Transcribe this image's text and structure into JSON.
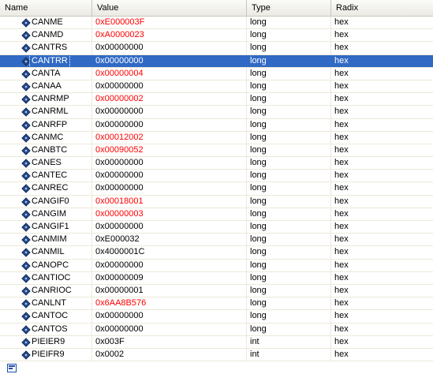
{
  "header": {
    "name": "Name",
    "value": "Value",
    "type": "Type",
    "radix": "Radix"
  },
  "colors": {
    "selection": "#316ac5",
    "changed_value": "#ff0000"
  },
  "rows": [
    {
      "name": "CANME",
      "value": "0xE000003F",
      "type": "long",
      "radix": "hex",
      "changed": true
    },
    {
      "name": "CANMD",
      "value": "0xA0000023",
      "type": "long",
      "radix": "hex",
      "changed": true
    },
    {
      "name": "CANTRS",
      "value": "0x00000000",
      "type": "long",
      "radix": "hex",
      "changed": false
    },
    {
      "name": "CANTRR",
      "value": "0x00000000",
      "type": "long",
      "radix": "hex",
      "changed": false,
      "selected": true
    },
    {
      "name": "CANTA",
      "value": "0x00000004",
      "type": "long",
      "radix": "hex",
      "changed": true
    },
    {
      "name": "CANAA",
      "value": "0x00000000",
      "type": "long",
      "radix": "hex",
      "changed": false
    },
    {
      "name": "CANRMP",
      "value": "0x00000002",
      "type": "long",
      "radix": "hex",
      "changed": true
    },
    {
      "name": "CANRML",
      "value": "0x00000000",
      "type": "long",
      "radix": "hex",
      "changed": false
    },
    {
      "name": "CANRFP",
      "value": "0x00000000",
      "type": "long",
      "radix": "hex",
      "changed": false
    },
    {
      "name": "CANMC",
      "value": "0x00012002",
      "type": "long",
      "radix": "hex",
      "changed": true
    },
    {
      "name": "CANBTC",
      "value": "0x00090052",
      "type": "long",
      "radix": "hex",
      "changed": true
    },
    {
      "name": "CANES",
      "value": "0x00000000",
      "type": "long",
      "radix": "hex",
      "changed": false
    },
    {
      "name": "CANTEC",
      "value": "0x00000000",
      "type": "long",
      "radix": "hex",
      "changed": false
    },
    {
      "name": "CANREC",
      "value": "0x00000000",
      "type": "long",
      "radix": "hex",
      "changed": false
    },
    {
      "name": "CANGIF0",
      "value": "0x00018001",
      "type": "long",
      "radix": "hex",
      "changed": true
    },
    {
      "name": "CANGIM",
      "value": "0x00000003",
      "type": "long",
      "radix": "hex",
      "changed": true
    },
    {
      "name": "CANGIF1",
      "value": "0x00000000",
      "type": "long",
      "radix": "hex",
      "changed": false
    },
    {
      "name": "CANMIM",
      "value": "0xE000032",
      "type": "long",
      "radix": "hex",
      "changed": false
    },
    {
      "name": "CANMIL",
      "value": "0x4000001C",
      "type": "long",
      "radix": "hex",
      "changed": false
    },
    {
      "name": "CANOPC",
      "value": "0x00000000",
      "type": "long",
      "radix": "hex",
      "changed": false
    },
    {
      "name": "CANTIOC",
      "value": "0x00000009",
      "type": "long",
      "radix": "hex",
      "changed": false
    },
    {
      "name": "CANRIOC",
      "value": "0x00000001",
      "type": "long",
      "radix": "hex",
      "changed": false
    },
    {
      "name": "CANLNT",
      "value": "0x6AA8B576",
      "type": "long",
      "radix": "hex",
      "changed": true
    },
    {
      "name": "CANTOC",
      "value": "0x00000000",
      "type": "long",
      "radix": "hex",
      "changed": false
    },
    {
      "name": "CANTOS",
      "value": "0x00000000",
      "type": "long",
      "radix": "hex",
      "changed": false
    },
    {
      "name": "PIEIER9",
      "value": "0x003F",
      "type": "int",
      "radix": "hex",
      "changed": false
    },
    {
      "name": "PIEIFR9",
      "value": "0x0002",
      "type": "int",
      "radix": "hex",
      "changed": false
    }
  ],
  "icons": {
    "row_icon": "register-diamond-icon",
    "new_row_icon": "add-watch-icon"
  }
}
